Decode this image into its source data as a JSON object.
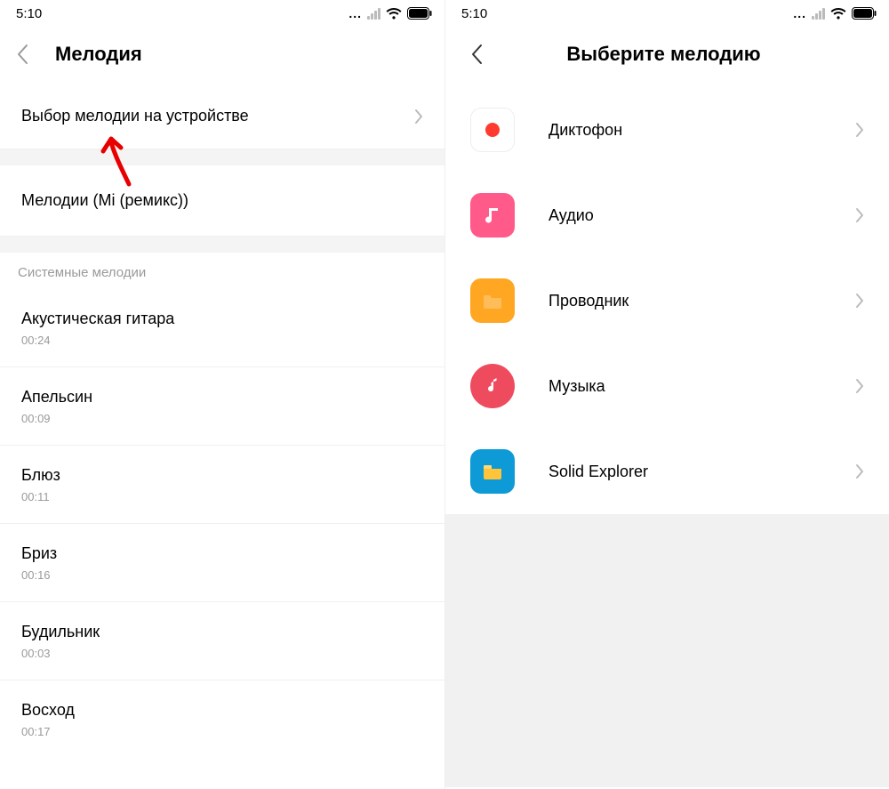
{
  "status": {
    "time": "5:10"
  },
  "left": {
    "title": "Мелодия",
    "choose_on_device": "Выбор мелодии на устройстве",
    "remix": "Мелодии (Mi (ремикс))",
    "section_header": "Системные мелодии",
    "ringtones": [
      {
        "name": "Акустическая гитара",
        "duration": "00:24"
      },
      {
        "name": "Апельсин",
        "duration": "00:09"
      },
      {
        "name": "Блюз",
        "duration": "00:11"
      },
      {
        "name": "Бриз",
        "duration": "00:16"
      },
      {
        "name": "Будильник",
        "duration": "00:03"
      },
      {
        "name": "Восход",
        "duration": "00:17"
      }
    ]
  },
  "right": {
    "title": "Выберите мелодию",
    "apps": [
      {
        "name": "Диктофон",
        "icon": "recorder",
        "color": "#ffffff"
      },
      {
        "name": "Аудио",
        "icon": "audio",
        "color": "#ff5a8a"
      },
      {
        "name": "Проводник",
        "icon": "files",
        "color": "#ffa722"
      },
      {
        "name": "Музыка",
        "icon": "music",
        "color": "#ef4b5f"
      },
      {
        "name": "Solid Explorer",
        "icon": "solid",
        "color": "#0d9ad6"
      }
    ]
  }
}
